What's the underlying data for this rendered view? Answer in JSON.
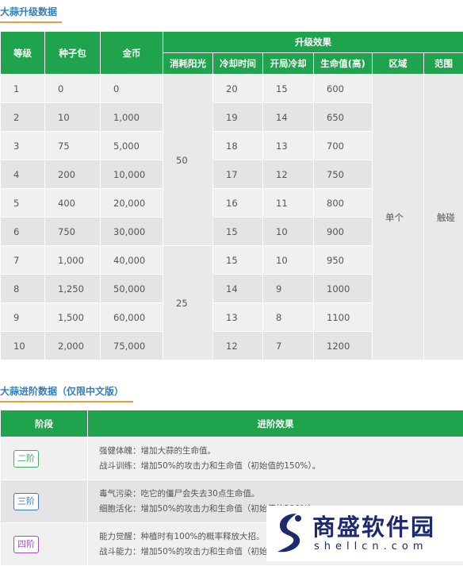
{
  "upgrade": {
    "title": "大蒜升级数据",
    "headers": {
      "level": "等级",
      "seed_pack": "种子包",
      "gold": "金币",
      "effect": "升级效果",
      "sun_cost": "消耗阳光",
      "cooldown": "冷却时间",
      "start_cooldown": "开局冷却",
      "hp": "生命值(高)",
      "area": "区域",
      "range": "范围"
    },
    "rows": [
      {
        "level": "1",
        "seed": "0",
        "gold": "0",
        "cooldown": "20",
        "start": "15",
        "hp": "600"
      },
      {
        "level": "2",
        "seed": "10",
        "gold": "1,000",
        "cooldown": "19",
        "start": "14",
        "hp": "650"
      },
      {
        "level": "3",
        "seed": "75",
        "gold": "5,000",
        "cooldown": "18",
        "start": "13",
        "hp": "700"
      },
      {
        "level": "4",
        "seed": "200",
        "gold": "10,000",
        "cooldown": "17",
        "start": "12",
        "hp": "750"
      },
      {
        "level": "5",
        "seed": "400",
        "gold": "20,000",
        "cooldown": "16",
        "start": "11",
        "hp": "800"
      },
      {
        "level": "6",
        "seed": "750",
        "gold": "30,000",
        "cooldown": "15",
        "start": "10",
        "hp": "900"
      },
      {
        "level": "7",
        "seed": "1,000",
        "gold": "40,000",
        "cooldown": "15",
        "start": "10",
        "hp": "950"
      },
      {
        "level": "8",
        "seed": "1,250",
        "gold": "50,000",
        "cooldown": "14",
        "start": "9",
        "hp": "1000"
      },
      {
        "level": "9",
        "seed": "1,500",
        "gold": "60,000",
        "cooldown": "13",
        "start": "8",
        "hp": "1100"
      },
      {
        "level": "10",
        "seed": "2,000",
        "gold": "75,000",
        "cooldown": "12",
        "start": "7",
        "hp": "1200"
      }
    ],
    "sun_groups": [
      "50",
      "25"
    ],
    "area_value": "单个",
    "range_value": "触碰"
  },
  "advance": {
    "title": "大蒜进阶数据（仅限中文版）",
    "headers": {
      "stage": "阶段",
      "effect": "进阶效果"
    },
    "rows": [
      {
        "stage": "二阶",
        "color": "#3dae63",
        "lines": [
          "强健体魄：增加大蒜的生命值。",
          "战斗训练：增加50%的攻击力和生命值（初始值的150%）。"
        ]
      },
      {
        "stage": "三阶",
        "color": "#3a7fd0",
        "lines": [
          "毒气污染：吃它的僵尸会失去30点生命值。",
          "细胞活化：增加50%的攻击力和生命值（初始值的200%）。"
        ]
      },
      {
        "stage": "四阶",
        "color": "#9a4fd6",
        "lines": [
          "能力觉醒：种植时有100%的概率释放大招。",
          "战斗能力：增加50%的攻击力和生命值（初始值的250%）。"
        ]
      }
    ]
  },
  "watermark": {
    "name": "商盛软件园",
    "url": "shellcn.com",
    "color": "#1d2a6e"
  }
}
